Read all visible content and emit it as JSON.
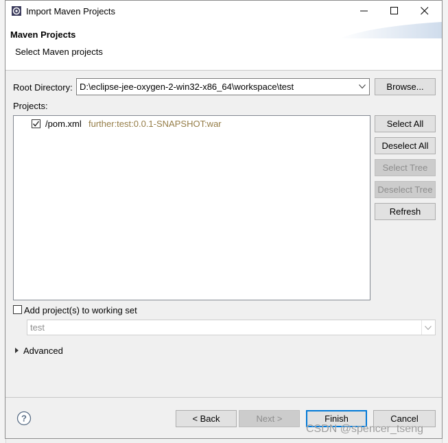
{
  "window": {
    "title": "Import Maven Projects"
  },
  "header": {
    "heading": "Maven Projects",
    "description": "Select Maven projects"
  },
  "root_directory": {
    "label": "Root Directory:",
    "value": "D:\\eclipse-jee-oxygen-2-win32-x86_64\\workspace\\test",
    "browse_label": "Browse..."
  },
  "projects": {
    "label": "Projects:",
    "items": [
      {
        "name": "/pom.xml",
        "gav": "further:test:0.0.1-SNAPSHOT:war",
        "checked": true
      }
    ]
  },
  "side_buttons": {
    "select_all": "Select All",
    "deselect_all": "Deselect All",
    "select_tree": "Select Tree",
    "deselect_tree": "Deselect Tree",
    "refresh": "Refresh"
  },
  "working_set": {
    "checkbox_label": "Add project(s) to working set",
    "checked": false,
    "value": "test"
  },
  "advanced": {
    "label": "Advanced"
  },
  "footer": {
    "back": "< Back",
    "next": "Next >",
    "finish": "Finish",
    "cancel": "Cancel"
  },
  "watermark": "CSDN @spencer_tseng",
  "colors": {
    "accent": "#0078d7",
    "gav_text": "#957d47"
  }
}
